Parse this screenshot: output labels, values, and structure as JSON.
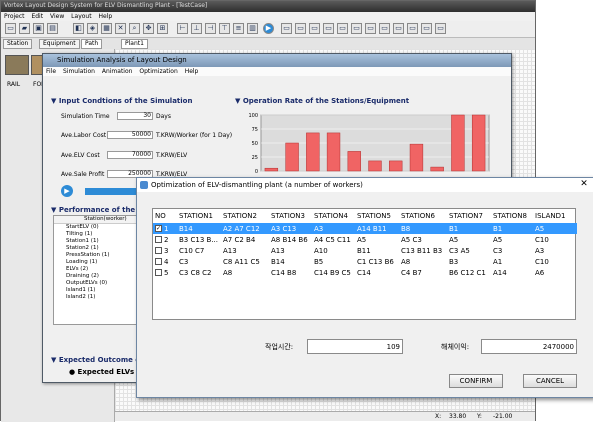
{
  "app": {
    "title": "Vortex Layout Design System for ELV Dismantling Plant - [TestCase]",
    "menu": [
      "Project",
      "Edit",
      "View",
      "Layout",
      "Help"
    ],
    "tabs": [
      "Station",
      "Equipment",
      "Path"
    ],
    "doc_tab": "Plant1",
    "side_labels": [
      "RAIL",
      "FOR"
    ],
    "status": {
      "x_label": "X:",
      "x": "33.80",
      "y_label": "Y:",
      "y": "-21.00"
    }
  },
  "sim": {
    "title": "Simulation Analysis of Layout Design",
    "menu": [
      "File",
      "Simulation",
      "Animation",
      "Optimization",
      "Help"
    ],
    "conditions_header": "Input Condtions of the Simulation",
    "fields": [
      {
        "label": "Simulation Time",
        "value": "30",
        "unit": "Days"
      },
      {
        "label": "Ave.Labor Cost",
        "value": "50000",
        "unit": "T.KRW/Worker (for 1 Day)"
      },
      {
        "label": "Ave.ELV Cost",
        "value": "70000",
        "unit": "T.KRW/ELV"
      },
      {
        "label": "Ave.Sale Profit",
        "value": "250000",
        "unit": "T.KRW/ELV"
      }
    ],
    "operation_header": "Operation Rate of the Stations/Equipment",
    "performance_header": "Performance of the Stat",
    "perf_col": "Station(worker)",
    "perf_rows": [
      "StartELV (0)",
      "Tilting (1)",
      "Station1 (1)",
      "Station2 (1)",
      "PressStation (1)",
      "Loading (1)",
      "ELVs (2)",
      "Draining (2)",
      "OutputELVs (0)",
      "Island1 (1)",
      "Island2 (1)"
    ],
    "expected_header": "Expected Outcome of th",
    "expected_row": "Expected ELVs Dis"
  },
  "chart_data": {
    "type": "bar",
    "yticks": [
      "100",
      "75",
      "50",
      "25",
      "0"
    ],
    "ylim": [
      0,
      100
    ],
    "values": [
      5,
      50,
      68,
      68,
      35,
      18,
      18,
      48,
      7,
      100,
      100
    ],
    "grid": true,
    "color": "#f06464"
  },
  "dialog": {
    "title": "Optimization of ELV-dismantling plant (a number of workers)",
    "close": "✕",
    "columns": [
      "NO",
      "STATION1",
      "STATION2",
      "STATION3",
      "STATION4",
      "STATION5",
      "STATION6",
      "STATION7",
      "STATION8",
      "ISLAND1"
    ],
    "rows": [
      {
        "no": "1",
        "checked": true,
        "cells": [
          "B14",
          "A2 A7 C12",
          "A3 C13",
          "A3",
          "A14 B11",
          "B8",
          "B1",
          "B1",
          "A5"
        ]
      },
      {
        "no": "2",
        "checked": false,
        "cells": [
          "B3 C13 B...",
          "A7 C2 B4",
          "A8 B14 B6",
          "A4 C5 C11",
          "A5",
          "A5 C3",
          "A5",
          "A5",
          "C10"
        ]
      },
      {
        "no": "3",
        "checked": false,
        "cells": [
          "C10 C7",
          "A13",
          "A13",
          "A10",
          "B11",
          "C13 B11 B3",
          "C3 A5",
          "C3",
          "A3"
        ]
      },
      {
        "no": "4",
        "checked": false,
        "cells": [
          "C3",
          "C8 A11 C5",
          "B14",
          "B5",
          "C1 C13 B6",
          "A8",
          "B3",
          "A1",
          "C10"
        ]
      },
      {
        "no": "5",
        "checked": false,
        "cells": [
          "C3 C8 C2",
          "A8",
          "C14 B8",
          "C14 B9 C5",
          "C14",
          "C4 B7",
          "B6 C12 C1",
          "A14",
          "A6"
        ]
      }
    ],
    "work_time_label": "작업시간:",
    "work_time_value": "109",
    "profit_label": "해체이익:",
    "profit_value": "2470000",
    "confirm": "CONFIRM",
    "cancel": "CANCEL"
  }
}
